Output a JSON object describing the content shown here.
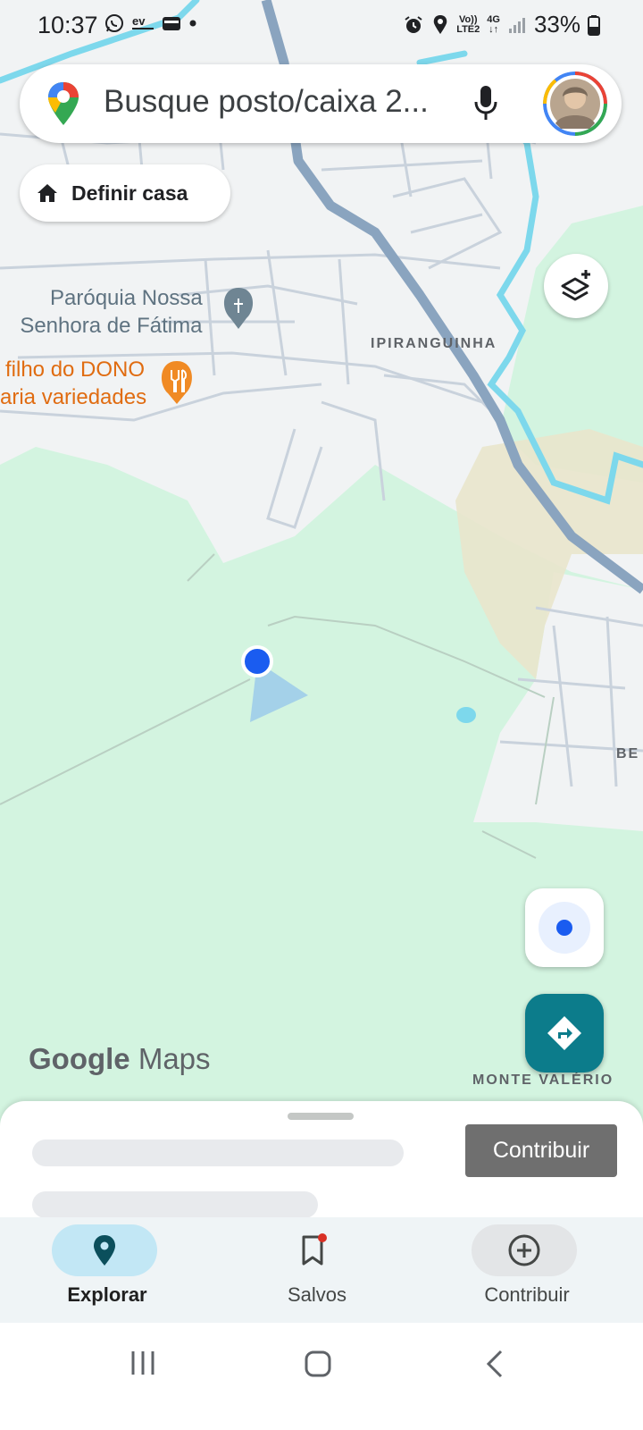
{
  "status_bar": {
    "time": "10:37",
    "left_icons": [
      "whatsapp-icon",
      "ev-icon",
      "wallet-icon",
      "dot-icon"
    ],
    "right_icons": [
      "alarm-icon",
      "location-icon",
      "volte-icon",
      "4g-icon",
      "signal-icon",
      "battery-icon"
    ],
    "volte_top": "Vo))",
    "volte_bottom": "LTE2",
    "network": "4G",
    "battery": "33%"
  },
  "search": {
    "placeholder": "Busque posto/caixa 2...",
    "logo_icon": "google-maps-pin-icon",
    "mic_icon": "mic-icon",
    "avatar_icon": "user-avatar"
  },
  "home_chip": {
    "label": "Definir casa",
    "icon": "home-icon"
  },
  "layers_button": {
    "icon": "layers-add-icon"
  },
  "map": {
    "place_church_line1": "Paróquia Nossa",
    "place_church_line2": "Senhora de Fátima",
    "place_church_icon": "cross-icon",
    "place_restaurant_line1": "filho do DONO",
    "place_restaurant_line2": "aria variedades",
    "place_restaurant_icon": "fork-knife-icon",
    "area_ipiranguinha": "IPIRANGUINHA",
    "area_monte_valerio": "MONTE VALÉRIO",
    "area_be": "BE",
    "colors": {
      "land": "#d3f4e0",
      "urban": "#f1f3f4",
      "water": "#7dd8ec",
      "highway": "#8aa4bf",
      "sand": "#e9e5cc"
    }
  },
  "branding": {
    "google": "Google",
    "maps": "Maps"
  },
  "my_location_button": {
    "icon": "my-location-icon"
  },
  "directions_button": {
    "icon": "directions-icon",
    "color": "#0c7c8b"
  },
  "bottom_sheet": {
    "contribute_label": "Contribuir"
  },
  "bottom_nav": {
    "items": [
      {
        "label": "Explorar",
        "icon": "explore-pin-icon",
        "active": true
      },
      {
        "label": "Salvos",
        "icon": "bookmark-icon",
        "active": false
      },
      {
        "label": "Contribuir",
        "icon": "add-circle-icon",
        "active": false
      }
    ]
  },
  "system_nav": {
    "icons": [
      "recents-icon",
      "home-icon",
      "back-icon"
    ]
  }
}
